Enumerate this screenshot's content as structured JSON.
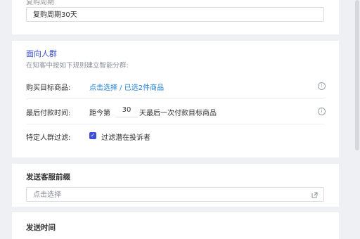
{
  "cycle": {
    "label": "复购周期",
    "value": "复购周期30天"
  },
  "audience": {
    "title": "面向人群",
    "subtitle": "在知客中按如下规则建立智能分群:",
    "rows": [
      {
        "label": "购买目标商品:",
        "link": "点击选择 / 已选2件商品"
      },
      {
        "label": "最后付款时间:",
        "prefix": "距今第",
        "days": "30",
        "suffix": "天最后一次付款目标商品"
      },
      {
        "label": "特定人群过滤:",
        "checkbox_label": "过滤潜在投诉者",
        "checked": true
      }
    ]
  },
  "prefix_section": {
    "title": "发送客服前缀",
    "placeholder": "点击选择"
  },
  "time_section": {
    "title": "发送时间"
  },
  "colors": {
    "accent": "#3b4fd8",
    "link": "#1e7fd6",
    "page_bg": "#eef0f4"
  }
}
